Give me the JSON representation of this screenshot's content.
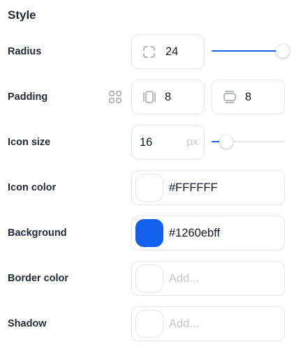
{
  "section": {
    "title": "Style"
  },
  "radius": {
    "label": "Radius",
    "value": "24",
    "slider_value": 0.97
  },
  "padding": {
    "label": "Padding",
    "vertical": "8",
    "horizontal": "8"
  },
  "icon_size": {
    "label": "Icon size",
    "value": "16",
    "unit": "px",
    "slider_value": 0.2
  },
  "icon_color": {
    "label": "Icon color",
    "value": "#FFFFFF",
    "swatch": "#ffffff"
  },
  "background": {
    "label": "Background",
    "value": "#1260ebff",
    "swatch": "#1260eb"
  },
  "border_color": {
    "label": "Border color",
    "placeholder": "Add..."
  },
  "shadow": {
    "label": "Shadow",
    "placeholder": "Add..."
  },
  "colors": {
    "accent": "#1260eb"
  },
  "icons": {
    "radius": "corner-radius-icon",
    "padding_mode": "grid-icon",
    "padding_v": "padding-vertical-icon",
    "padding_h": "padding-horizontal-icon"
  }
}
